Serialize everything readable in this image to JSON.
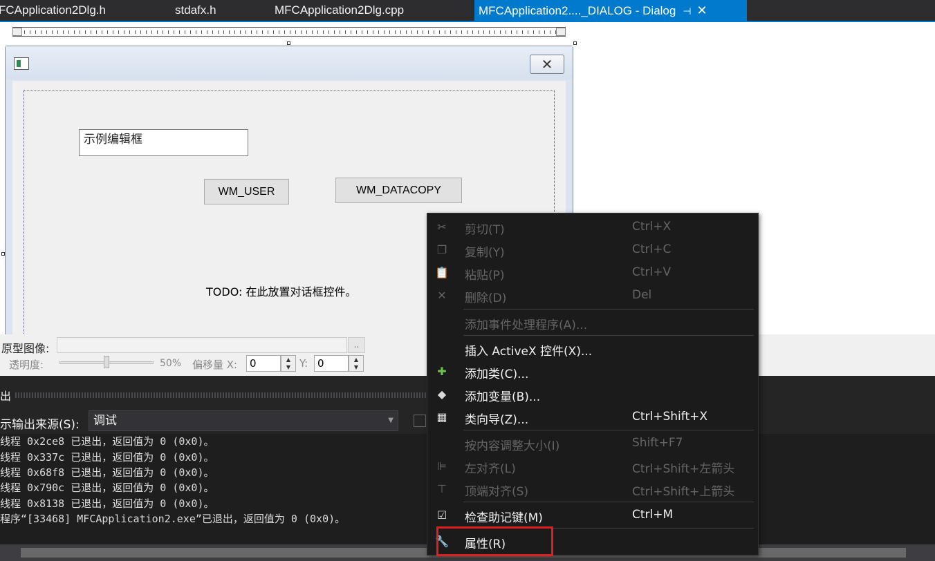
{
  "tabs": [
    {
      "label": "FCApplication2Dlg.h",
      "active": false
    },
    {
      "label": "stdafx.h",
      "active": false
    },
    {
      "label": "MFCApplication2Dlg.cpp",
      "active": false
    },
    {
      "label": "MFCApplication2...._DIALOG - Dialog",
      "active": true,
      "pin_glyph": "⊣",
      "close_glyph": "✕"
    }
  ],
  "dialog": {
    "close_glyph": "✕",
    "edit_text": "示例编辑框",
    "button_user": "WM_USER",
    "button_datacopy": "WM_DATACOPY",
    "todo_text": "TODO: 在此放置对话框控件。"
  },
  "prototype": {
    "label": "原型图像:",
    "browse": "..",
    "opacity_label": "透明度:",
    "opacity_value": "50%",
    "opacity_level": 0.5,
    "offset_x_label": "偏移量 X:",
    "offset_x": "0",
    "offset_y_label": "Y:",
    "offset_y": "0",
    "spin_up": "▲",
    "spin_down": "▼"
  },
  "output": {
    "title": "出",
    "source_label": "示输出来源(S):",
    "source_value": "调试",
    "lines": [
      "线程 0x2ce8 已退出，返回值为 0 (0x0)。",
      "线程 0x337c 已退出，返回值为 0 (0x0)。",
      "线程 0x68f8 已退出，返回值为 0 (0x0)。",
      "线程 0x790c 已退出，返回值为 0 (0x0)。",
      "线程 0x8138 已退出，返回值为 0 (0x0)。",
      "程序“[33468] MFCApplication2.exe”已退出，返回值为 0 (0x0)。"
    ]
  },
  "context_menu": {
    "items": [
      {
        "label": "剪切(T)",
        "shortcut": "Ctrl+X",
        "icon": "scissors-icon",
        "glyph": "✂",
        "enabled": false
      },
      {
        "label": "复制(Y)",
        "shortcut": "Ctrl+C",
        "icon": "copy-icon",
        "glyph": "❐",
        "enabled": false
      },
      {
        "label": "粘贴(P)",
        "shortcut": "Ctrl+V",
        "icon": "paste-icon",
        "glyph": "📋",
        "enabled": false
      },
      {
        "label": "删除(D)",
        "shortcut": "Del",
        "icon": "delete-icon",
        "glyph": "✕",
        "enabled": false
      },
      {
        "label": "添加事件处理程序(A)...",
        "shortcut": "",
        "icon": "",
        "glyph": "",
        "enabled": false
      },
      {
        "label": "插入 ActiveX 控件(X)...",
        "shortcut": "",
        "icon": "",
        "glyph": "",
        "enabled": true
      },
      {
        "label": "添加类(C)...",
        "shortcut": "",
        "icon": "add-class-icon",
        "glyph": "✚",
        "enabled": true
      },
      {
        "label": "添加变量(B)...",
        "shortcut": "",
        "icon": "add-variable-icon",
        "glyph": "◆",
        "enabled": true
      },
      {
        "label": "类向导(Z)...",
        "shortcut": "Ctrl+Shift+X",
        "icon": "class-wizard-icon",
        "glyph": "▦",
        "enabled": true
      },
      {
        "label": "按内容调整大小(I)",
        "shortcut": "Shift+F7",
        "icon": "",
        "glyph": "",
        "enabled": false
      },
      {
        "label": "左对齐(L)",
        "shortcut": "Ctrl+Shift+左箭头",
        "icon": "align-left-icon",
        "glyph": "⊫",
        "enabled": false
      },
      {
        "label": "顶端对齐(S)",
        "shortcut": "Ctrl+Shift+上箭头",
        "icon": "align-top-icon",
        "glyph": "⊤",
        "enabled": false
      },
      {
        "label": "检查助记键(M)",
        "shortcut": "Ctrl+M",
        "icon": "check-mnemonics-icon",
        "glyph": "☑",
        "enabled": true
      },
      {
        "label": "属性(R)",
        "shortcut": "",
        "icon": "wrench-icon",
        "glyph": "🔧",
        "enabled": true
      }
    ]
  },
  "colors": {
    "accent": "#007acc",
    "highlight": "#e02020",
    "menu_bg": "#1b1b1c"
  }
}
